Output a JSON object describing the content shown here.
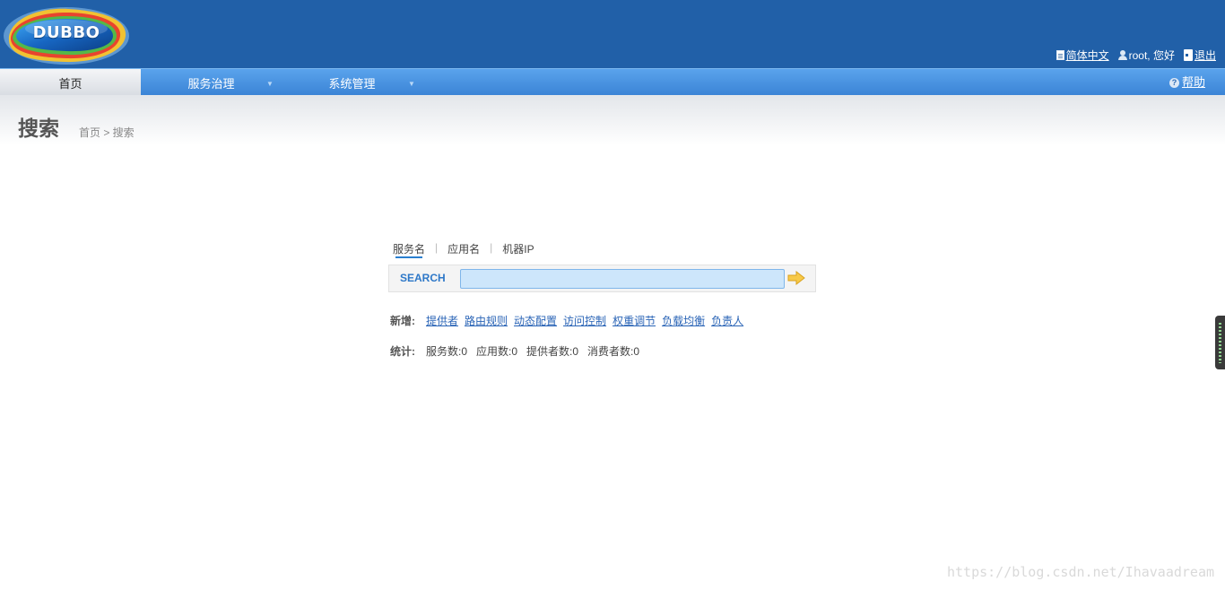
{
  "header": {
    "logo_text": "DUBBO",
    "language_label": "简体中文",
    "greeting": "root, 您好",
    "logout_label": "退出"
  },
  "nav": {
    "items": [
      {
        "label": "首页",
        "active": true
      },
      {
        "label": "服务治理",
        "active": false
      },
      {
        "label": "系统管理",
        "active": false
      }
    ],
    "help_label": "帮助"
  },
  "page": {
    "title": "搜索",
    "breadcrumb": "首页 > 搜索"
  },
  "search": {
    "tabs": [
      "服务名",
      "应用名",
      "机器IP"
    ],
    "active_tab": "服务名",
    "label": "SEARCH",
    "value": ""
  },
  "add": {
    "label": "新增:",
    "links": [
      "提供者",
      "路由规则",
      "动态配置",
      "访问控制",
      "权重调节",
      "负载均衡",
      "负责人"
    ]
  },
  "stats": {
    "label": "统计:",
    "items": [
      "服务数:0",
      "应用数:0",
      "提供者数:0",
      "消费者数:0"
    ]
  },
  "watermark": "https://blog.csdn.net/Ihavaadream",
  "colors": {
    "header_bg": "#2160a8",
    "nav_bg": "#4a94e2",
    "link": "#2a64b6"
  }
}
